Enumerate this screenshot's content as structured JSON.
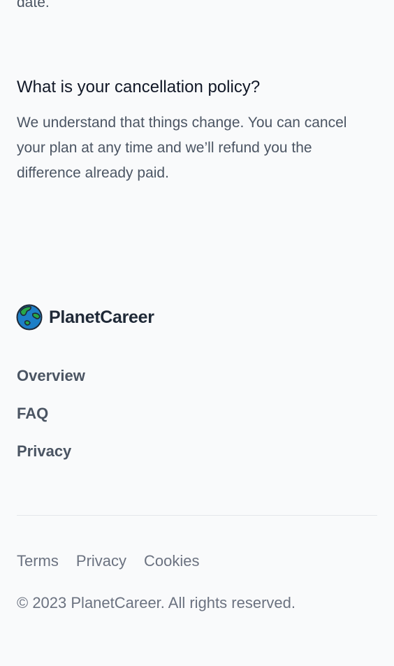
{
  "faq_partial": {
    "tail_text": "date."
  },
  "faq_item": {
    "question": "What is your cancellation policy?",
    "answer": "We understand that things change. You can cancel your plan at any time and we’ll refund you the difference already paid."
  },
  "footer": {
    "logo": {
      "icon": "globe-icon",
      "name": "PlanetCareer"
    },
    "nav": [
      {
        "label": "Overview"
      },
      {
        "label": "FAQ"
      },
      {
        "label": "Privacy"
      }
    ],
    "legal_links": [
      {
        "label": "Terms"
      },
      {
        "label": "Privacy"
      },
      {
        "label": "Cookies"
      }
    ],
    "copyright": "© 2023 PlanetCareer. All rights reserved."
  },
  "colors": {
    "background": "#f9fafb",
    "heading": "#111827",
    "body_text": "#4b5563",
    "muted_text": "#6b7280",
    "globe_ocean": "#1d7fc7",
    "globe_land": "#27a84a"
  }
}
